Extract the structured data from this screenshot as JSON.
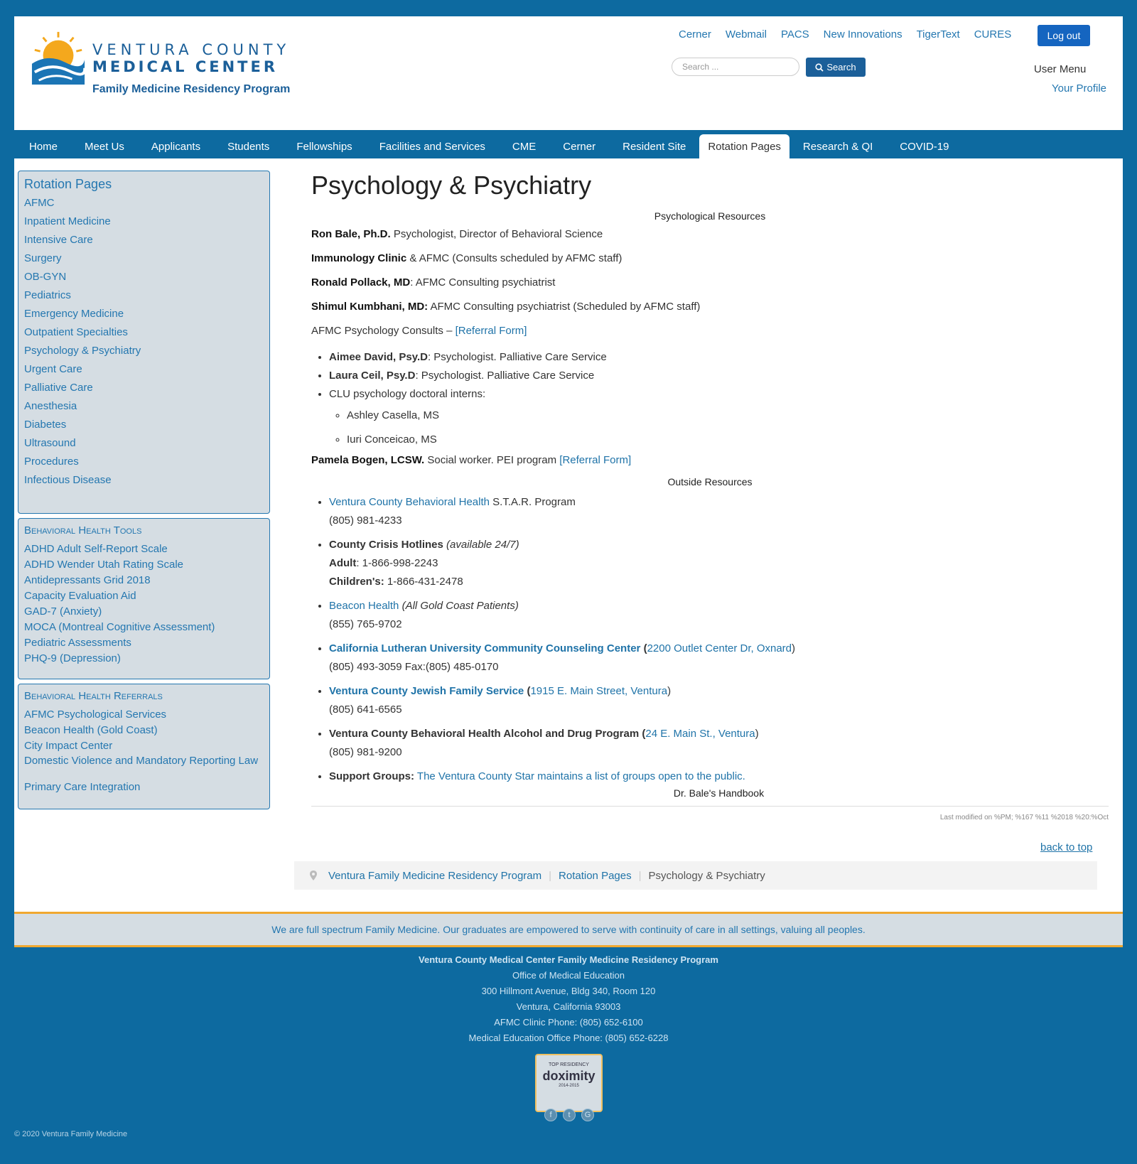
{
  "header": {
    "logo": {
      "line1": "VENTURA COUNTY",
      "line2": "MEDICAL CENTER",
      "line3": "Family Medicine Residency Program"
    },
    "top_links": [
      "Cerner",
      "Webmail",
      "PACS",
      "New Innovations",
      "TigerText",
      "CURES"
    ],
    "logout": "Log out",
    "search_placeholder": "Search ...",
    "search_button": "Search",
    "user_menu": "User Menu",
    "your_profile": "Your Profile"
  },
  "nav": {
    "items": [
      "Home",
      "Meet Us",
      "Applicants",
      "Students",
      "Fellowships",
      "Facilities and Services",
      "CME",
      "Cerner",
      "Resident Site",
      "Rotation Pages",
      "Research & QI",
      "COVID-19"
    ],
    "active": "Rotation Pages"
  },
  "sidebar": {
    "rotation": {
      "title": "Rotation Pages",
      "items": [
        "AFMC",
        "Inpatient Medicine",
        "Intensive Care",
        "Surgery",
        "OB-GYN",
        "Pediatrics",
        "Emergency Medicine",
        "Outpatient Specialties",
        "Psychology & Psychiatry",
        "Urgent Care",
        "Palliative Care",
        "Anesthesia",
        "Diabetes",
        "Ultrasound",
        "Procedures",
        "Infectious Disease"
      ]
    },
    "tools": {
      "title": "Behavioral Health Tools",
      "items": [
        "ADHD Adult Self-Report Scale",
        "ADHD Wender Utah Rating Scale",
        "Antidepressants Grid 2018",
        "Capacity Evaluation Aid",
        "GAD-7 (Anxiety)",
        "MOCA (Montreal Cognitive Assessment)",
        "Pediatric Assessments",
        "PHQ-9 (Depression)"
      ]
    },
    "referrals": {
      "title": "Behavioral Health Referrals",
      "items": [
        "AFMC Psychological Services",
        "Beacon Health (Gold Coast)",
        "City Impact Center",
        "Domestic Violence and Mandatory Reporting Law",
        "Primary Care Integration"
      ]
    }
  },
  "main": {
    "title": "Psychology & Psychiatry",
    "psych_resources_heading": "Psychological Resources",
    "people": [
      {
        "name": "Ron Bale, Ph.D.",
        "desc": " Psychologist, Director of Behavioral Science"
      },
      {
        "name": "Immunology Clinic",
        "desc": " & AFMC (Consults scheduled by AFMC staff)"
      },
      {
        "name": "Ronald Pollack, MD",
        "desc": ": AFMC Consulting psychiatrist"
      },
      {
        "name": "Shimul Kumbhani, MD:",
        "desc": " AFMC Consulting psychiatrist (Scheduled by AFMC staff)"
      }
    ],
    "consults_text": "AFMC Psychology Consults – ",
    "referral_form": "[Referral Form]",
    "consult_list": [
      {
        "name": "Aimee David, Psy.D",
        "desc": ": Psychologist. Palliative Care Service"
      },
      {
        "name": "Laura Ceil, Psy.D",
        "desc": ": Psychologist. Palliative Care Service"
      }
    ],
    "interns_label": "CLU psychology doctoral interns:",
    "interns": [
      "Ashley Casella, MS",
      "Iuri Conceicao, MS"
    ],
    "pamela": {
      "name": "Pamela Bogen, LCSW.",
      "desc": " Social worker. PEI program ",
      "link": "[Referral Form]"
    },
    "outside_heading": "Outside Resources",
    "outside": {
      "vcbh": {
        "link": "Ventura County Behavioral Health",
        "text": " S.T.A.R. Program",
        "phone": "(805) 981-4233"
      },
      "crisis": {
        "label": "County Crisis Hotlines",
        "note": "(available 24/7)",
        "adult_label": "Adult",
        "adult": ": 1-866-998-2243",
        "children_label": "Children's:",
        "children": " 1-866-431-2478"
      },
      "beacon": {
        "link": "Beacon Health",
        "note": "(All Gold Coast Patients)",
        "phone": "(855) 765-9702"
      },
      "clu": {
        "link": "California Lutheran University Community Counseling Center",
        "addr": "2200 Outlet Center Dr, Oxnard",
        "phone": "(805) 493-3059 Fax:(805) 485-0170"
      },
      "jfs": {
        "link": "Ventura County Jewish Family Service",
        "addr": "1915 E. Main Street, Ventura",
        "phone": "(805) 641-6565"
      },
      "adp": {
        "label": "Ventura County Behavioral Health Alcohol and Drug Program",
        "addr": "24 E. Main St., Ventura",
        "phone": "(805) 981-9200"
      },
      "support": {
        "label": "Support Groups:",
        "link": "The Ventura County Star maintains a list of groups open to the public."
      }
    },
    "handbook": "Dr. Bale's Handbook",
    "last_modified": "Last modified on %PM; %167 %11 %2018 %20:%Oct",
    "back_to_top": "back to top"
  },
  "breadcrumb": [
    "Ventura Family Medicine Residency Program",
    "Rotation Pages",
    "Psychology & Psychiatry"
  ],
  "footer": {
    "mission": "We are full spectrum Family Medicine. Our graduates are empowered to serve with continuity of care in all settings, valuing all peoples.",
    "name": "Ventura County Medical Center Family Medicine Residency Program",
    "lines": [
      "Office of Medical Education",
      "300 Hillmont Avenue, Bldg 340, Room 120",
      "Ventura, California 93003",
      "AFMC Clinic Phone: (805) 652-6100",
      "Medical Education Office Phone: (805) 652-6228"
    ],
    "badge": {
      "top": "TOP RESIDENCY",
      "brand": "doximity",
      "years": "2014-2015"
    },
    "copyright": "© 2020 Ventura Family Medicine"
  },
  "colors": {
    "brand_blue": "#0d6aa0",
    "link": "#2477b0",
    "accent_gold": "#f0a830",
    "panel_bg": "#d5dde3"
  }
}
